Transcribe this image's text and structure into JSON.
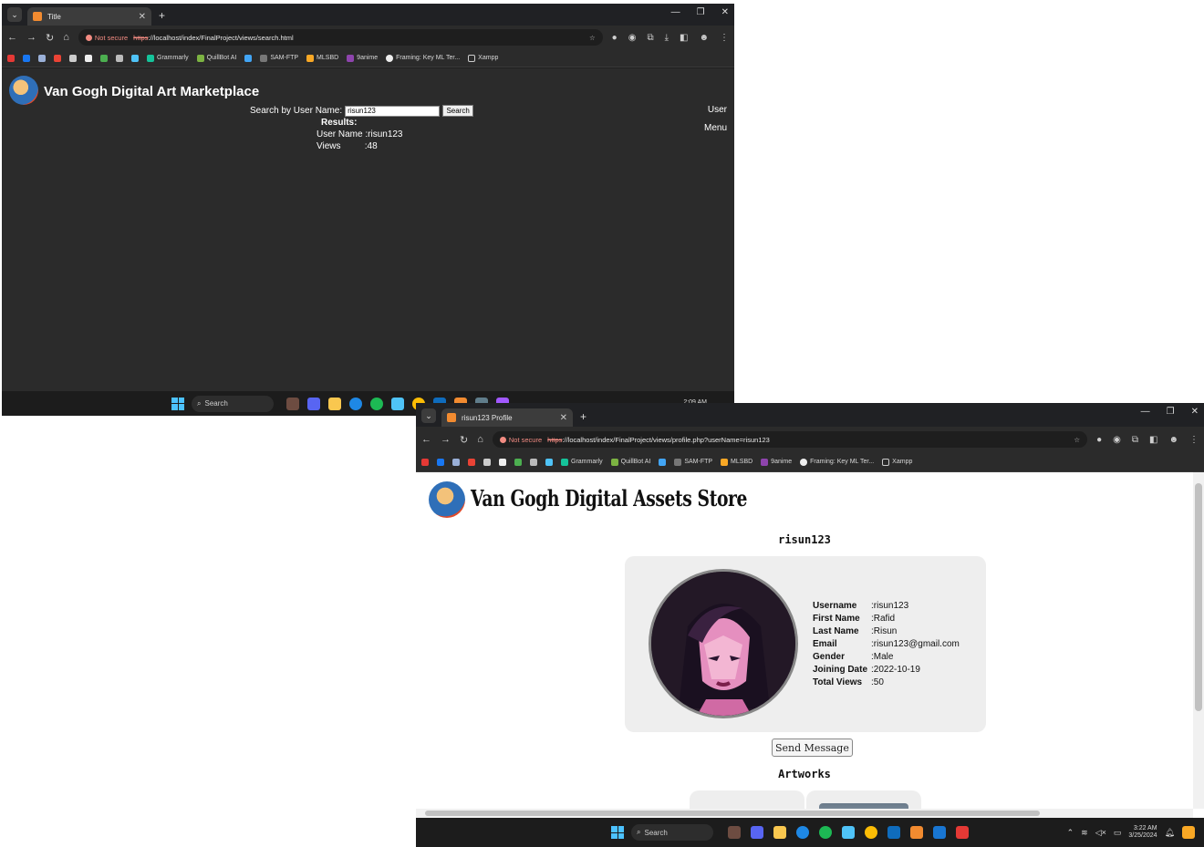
{
  "shot1": {
    "tab_title": "Title",
    "omnibox": {
      "not_secure": "Not secure",
      "scheme": "https",
      "url_rest": "://localhost/index/FinalProject/views/search.html"
    },
    "bookmarks": [
      "Grammarly",
      "QuillBot AI",
      "SAM-FTP",
      "MLSBD",
      "9anime",
      "Framing: Key ML Ter...",
      "Xampp"
    ],
    "brand": "Van Gogh Digital Art Marketplace",
    "search_label": "Search by User Name:",
    "search_value": "risun123",
    "search_button": "Search",
    "results_heading": "Results:",
    "result_user_label": "User Name",
    "result_user_value": ":risun123",
    "result_views_label": "Views",
    "result_views_value": ":48",
    "side_user": "User",
    "side_menu": "Menu",
    "taskbar_search": "Search",
    "clock": "2:09 AM"
  },
  "shot2": {
    "tab_title": "risun123 Profile",
    "omnibox": {
      "not_secure": "Not secure",
      "scheme": "https",
      "url_rest": "://localhost/index/FinalProject/views/profile.php?userName=risun123"
    },
    "bookmarks": [
      "Grammarly",
      "QuillBot AI",
      "SAM-FTP",
      "MLSBD",
      "9anime",
      "Framing: Key ML Ter...",
      "Xampp"
    ],
    "brand": "Van Gogh Digital Assets Store",
    "username_title": "risun123",
    "details": [
      {
        "label": "Username",
        "value": ":risun123"
      },
      {
        "label": "First Name",
        "value": ":Rafid"
      },
      {
        "label": "Last Name",
        "value": ":Risun"
      },
      {
        "label": "Email",
        "value": ":risun123@gmail.com"
      },
      {
        "label": "Gender",
        "value": ":Male"
      },
      {
        "label": "Joining Date",
        "value": ":2022-10-19"
      },
      {
        "label": "Total Views",
        "value": ":50"
      }
    ],
    "send_message": "Send Message",
    "artworks_title": "Artworks",
    "taskbar_search": "Search",
    "clock_time": "3:22 AM",
    "clock_date": "3/25/2024"
  }
}
